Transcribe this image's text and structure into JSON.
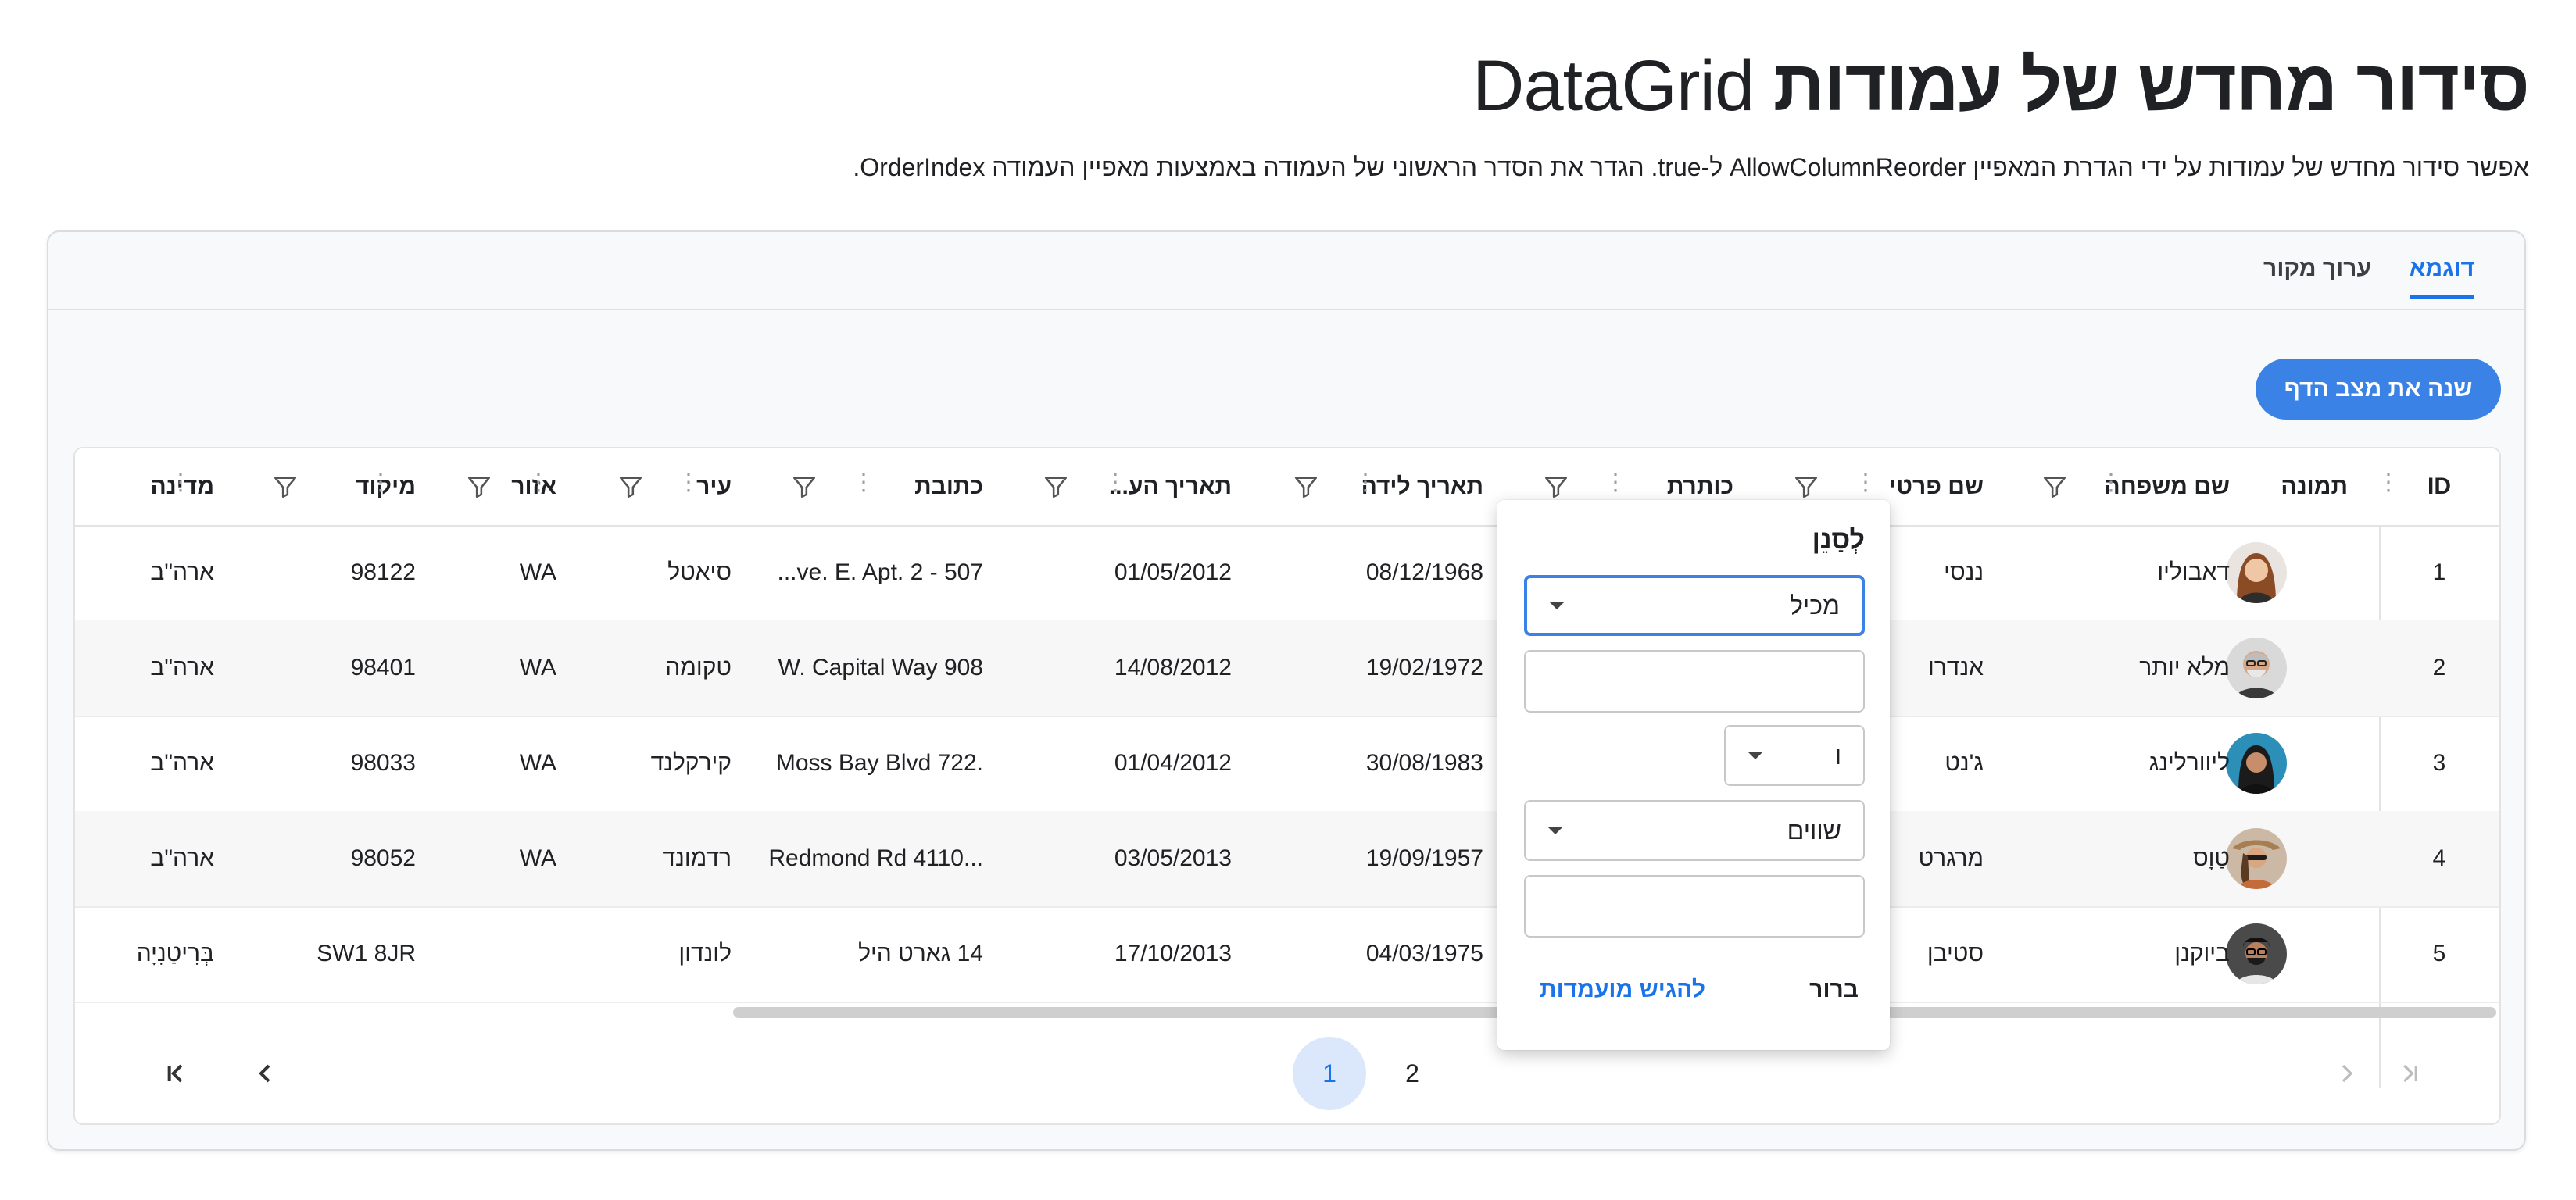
{
  "page": {
    "title_he": "סידור מחדש של עמודות",
    "title_en": "DataGrid",
    "description": "אפשר סידור מחדש של עמודות על ידי הגדרת המאפיין AllowColumnReorder ל-true. הגדר את הסדר הראשוני של העמודה באמצעות מאפיין העמודה OrderIndex."
  },
  "tabs": [
    "דוגמא",
    "ערוך מקור"
  ],
  "toolbar": {
    "change_page_state": "שנה את מצב הדף"
  },
  "grid": {
    "columns": {
      "id": "ID",
      "photo": "תמונה",
      "last_name": "שם משפחה",
      "first_name": "שם פרטי",
      "title": "כותרת",
      "birth_date": "תאריך לידה",
      "hire_date": "תאריך הע...",
      "address": "כתובת",
      "city": "עיר",
      "region": "אזור",
      "postal_code": "מיקוד",
      "country": "מדינה"
    },
    "rows": [
      {
        "id": "1",
        "last_name": "דאבוליו",
        "first_name": "ננסי",
        "birth_date": "08/12/1968",
        "hire_date": "01/05/2012",
        "address": "507 - 20th Ave. E. Apt. 2...",
        "address_display": "...ve. E. Apt. 2 - 507",
        "city": "סיאטל",
        "region": "WA",
        "postal_code": "98122",
        "country": "ארה\"ב"
      },
      {
        "id": "2",
        "last_name": "מלא יותר",
        "first_name": "אנדרו",
        "birth_date": "19/02/1972",
        "hire_date": "14/08/2012",
        "address_display": "W. Capital Way 908",
        "city": "טקומה",
        "region": "WA",
        "postal_code": "98401",
        "country": "ארה\"ב"
      },
      {
        "id": "3",
        "last_name": "ליוורלינג",
        "first_name": "ג'נט",
        "birth_date": "30/08/1983",
        "hire_date": "01/04/2012",
        "address_display": "Moss Bay Blvd 722.",
        "city": "קירקלנד",
        "region": "WA",
        "postal_code": "98033",
        "country": "ארה\"ב"
      },
      {
        "id": "4",
        "last_name": "טַוָס",
        "first_name": "מרגרט",
        "birth_date": "19/09/1957",
        "hire_date": "03/05/2013",
        "address_display": "Redmond Rd 4110...",
        "city": "רדמונד",
        "region": "WA",
        "postal_code": "98052",
        "country": "ארה\"ב"
      },
      {
        "id": "5",
        "last_name": "ביוקנן",
        "first_name": "סטיבן",
        "birth_date": "04/03/1975",
        "hire_date": "17/10/2013",
        "address_display": "14 גארט היל",
        "city": "לונדון",
        "region": "",
        "postal_code": "SW1 8JR",
        "country": "בְּרִיטַנִיָה"
      }
    ]
  },
  "pager": {
    "pages": [
      "1",
      "2"
    ],
    "current": "1"
  },
  "filter_popup": {
    "title": "לְסַנֵן",
    "operator1": "מכיל",
    "value1": "",
    "logic": "ו",
    "operator2": "שווים",
    "value2": "",
    "clear_label": "ברור",
    "apply_label": "להגיש מועמדות"
  },
  "colors": {
    "accent": "#3b82e6",
    "accent_text": "#1a73e8",
    "active_page_bg": "#dbe7fb"
  }
}
